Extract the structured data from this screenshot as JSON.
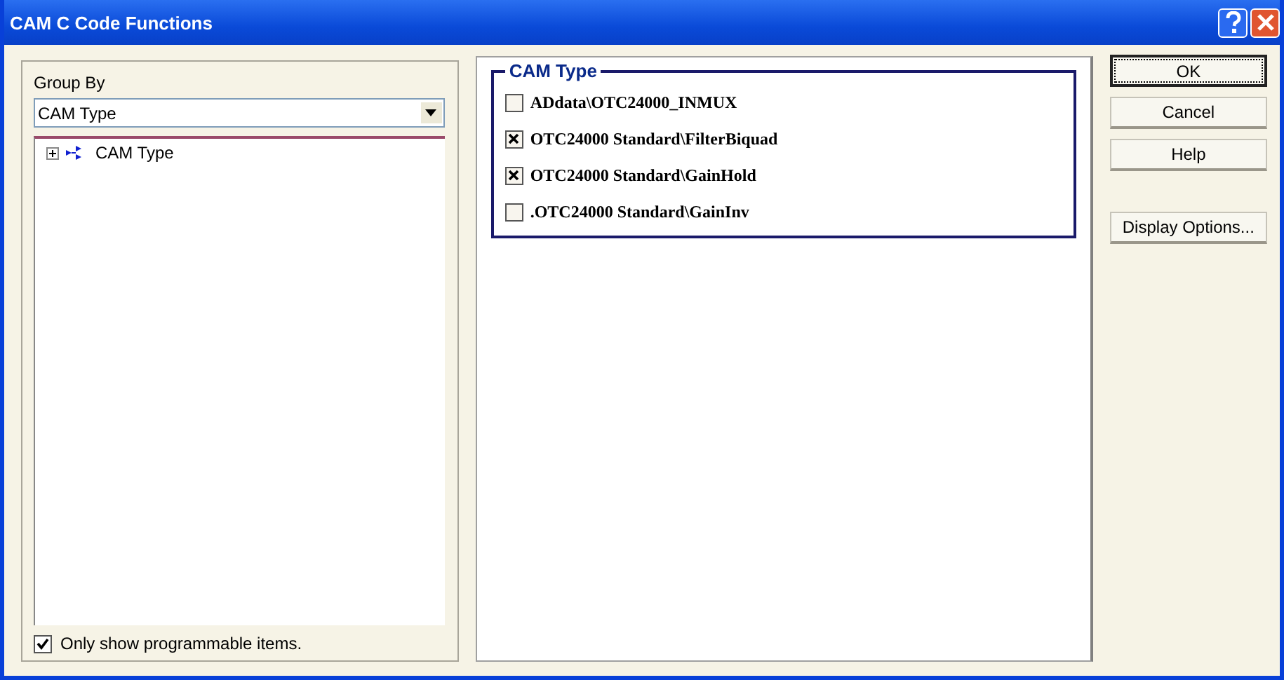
{
  "window": {
    "title": "CAM C Code Functions"
  },
  "group_by": {
    "label": "Group By",
    "value": "CAM Type"
  },
  "tree": [
    {
      "label": "CAM Type",
      "expanded": false
    }
  ],
  "only_programmable": {
    "label": "Only show programmable items.",
    "checked": true
  },
  "cam_type": {
    "title": "CAM Type",
    "items": [
      {
        "label": "ADdata\\OTC24000_INMUX",
        "checked": false
      },
      {
        "label": "OTC24000 Standard\\FilterBiquad",
        "checked": true
      },
      {
        "label": "OTC24000 Standard\\GainHold",
        "checked": true
      },
      {
        "label": ".OTC24000 Standard\\GainInv",
        "checked": false
      }
    ]
  },
  "buttons": [
    {
      "label": "OK",
      "default": true
    },
    {
      "label": "Cancel",
      "default": false
    },
    {
      "label": "Help",
      "default": false
    },
    {
      "label": "Display Options...",
      "default": false
    }
  ]
}
